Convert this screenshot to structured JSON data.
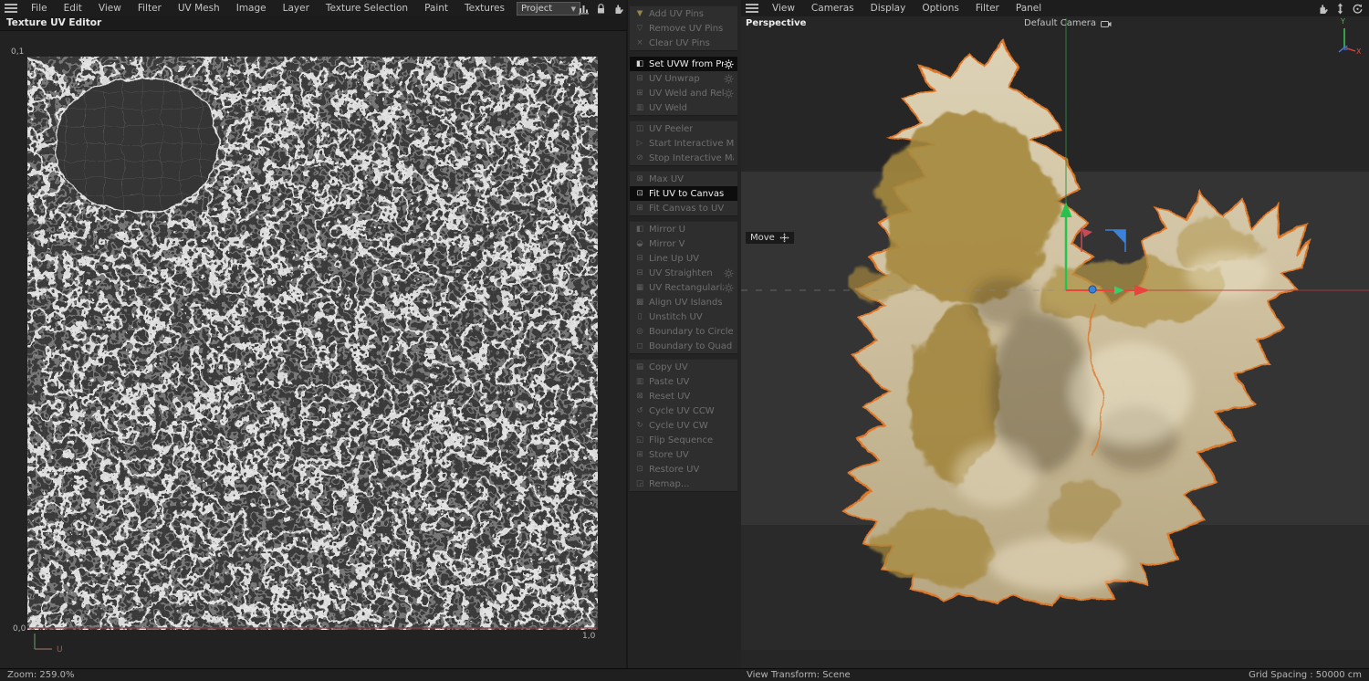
{
  "left_panel": {
    "menu": [
      "File",
      "Edit",
      "View",
      "Filter",
      "UV Mesh",
      "Image",
      "Layer",
      "Texture Selection",
      "Paint",
      "Textures"
    ],
    "tab_label": "Texture UV Editor",
    "project_selector": "Project",
    "canvas": {
      "label_top_left": "0,1",
      "label_bottom_left": "0,0",
      "label_bottom_right": "1,0",
      "axis_u_label": "U"
    },
    "status_zoom": "Zoom: 259.0%"
  },
  "uv_commands": {
    "groups": [
      {
        "items": [
          {
            "label": "Add UV Pins",
            "icon": "▼",
            "enabled": false
          },
          {
            "label": "Remove UV Pins",
            "icon": "▽",
            "enabled": false
          },
          {
            "label": "Clear UV Pins",
            "icon": "×",
            "enabled": false
          }
        ]
      },
      {
        "items": [
          {
            "label": "Set UVW from Projection",
            "icon": "◧",
            "enabled": true,
            "has_settings": true
          },
          {
            "label": "UV Unwrap",
            "icon": "⊟",
            "enabled": false,
            "has_settings": true
          },
          {
            "label": "UV Weld and Relax",
            "icon": "⊞",
            "enabled": false,
            "has_settings": true
          },
          {
            "label": "UV Weld",
            "icon": "▥",
            "enabled": false
          }
        ]
      },
      {
        "items": [
          {
            "label": "UV Peeler",
            "icon": "◫",
            "enabled": false
          },
          {
            "label": "Start Interactive Mapping",
            "icon": "▷",
            "enabled": false
          },
          {
            "label": "Stop Interactive Mapping",
            "icon": "⊘",
            "enabled": false
          }
        ]
      },
      {
        "items": [
          {
            "label": "Max UV",
            "icon": "⊠",
            "enabled": false
          },
          {
            "label": "Fit UV to Canvas",
            "icon": "⊡",
            "enabled": true
          },
          {
            "label": "Fit Canvas to UV",
            "icon": "⊞",
            "enabled": false
          }
        ]
      },
      {
        "items": [
          {
            "label": "Mirror U",
            "icon": "◧",
            "enabled": false
          },
          {
            "label": "Mirror V",
            "icon": "◒",
            "enabled": false
          },
          {
            "label": "Line Up UV",
            "icon": "⊟",
            "enabled": false
          },
          {
            "label": "UV Straighten",
            "icon": "⊟",
            "enabled": false,
            "has_settings": true
          },
          {
            "label": "UV Rectangularize",
            "icon": "▦",
            "enabled": false,
            "has_settings": true
          },
          {
            "label": "Align UV Islands",
            "icon": "▩",
            "enabled": false
          },
          {
            "label": "Unstitch UV",
            "icon": "▯",
            "enabled": false
          },
          {
            "label": "Boundary to Circle",
            "icon": "◎",
            "enabled": false
          },
          {
            "label": "Boundary to Quad",
            "icon": "◻",
            "enabled": false
          }
        ]
      },
      {
        "items": [
          {
            "label": "Copy UV",
            "icon": "▤",
            "enabled": false
          },
          {
            "label": "Paste UV",
            "icon": "▥",
            "enabled": false
          },
          {
            "label": "Reset UV",
            "icon": "⊠",
            "enabled": false
          },
          {
            "label": "Cycle UV CCW",
            "icon": "↺",
            "enabled": false
          },
          {
            "label": "Cycle UV CW",
            "icon": "↻",
            "enabled": false
          },
          {
            "label": "Flip Sequence",
            "icon": "◱",
            "enabled": false
          },
          {
            "label": "Store UV",
            "icon": "⊞",
            "enabled": false
          },
          {
            "label": "Restore UV",
            "icon": "⊡",
            "enabled": false
          },
          {
            "label": "Remap...",
            "icon": "◲",
            "enabled": false
          }
        ]
      }
    ]
  },
  "viewport": {
    "menu": [
      "View",
      "Cameras",
      "Display",
      "Options",
      "Filter",
      "Panel"
    ],
    "view_label": "Perspective",
    "camera_label": "Default Camera",
    "tool_label": "Move",
    "axis_gizmo": {
      "x": "X",
      "y": "Y",
      "z": "Z"
    },
    "status_view_transform": "View Transform: Scene",
    "status_grid_spacing": "Grid Spacing : 50000 cm"
  },
  "colors": {
    "selection_outline": "#e0782a",
    "axis_x": "#e8433c",
    "axis_y": "#27c24c",
    "axis_z": "#3b82d9",
    "uv_wire": "#efefef",
    "viewport_bg": "#343434"
  }
}
